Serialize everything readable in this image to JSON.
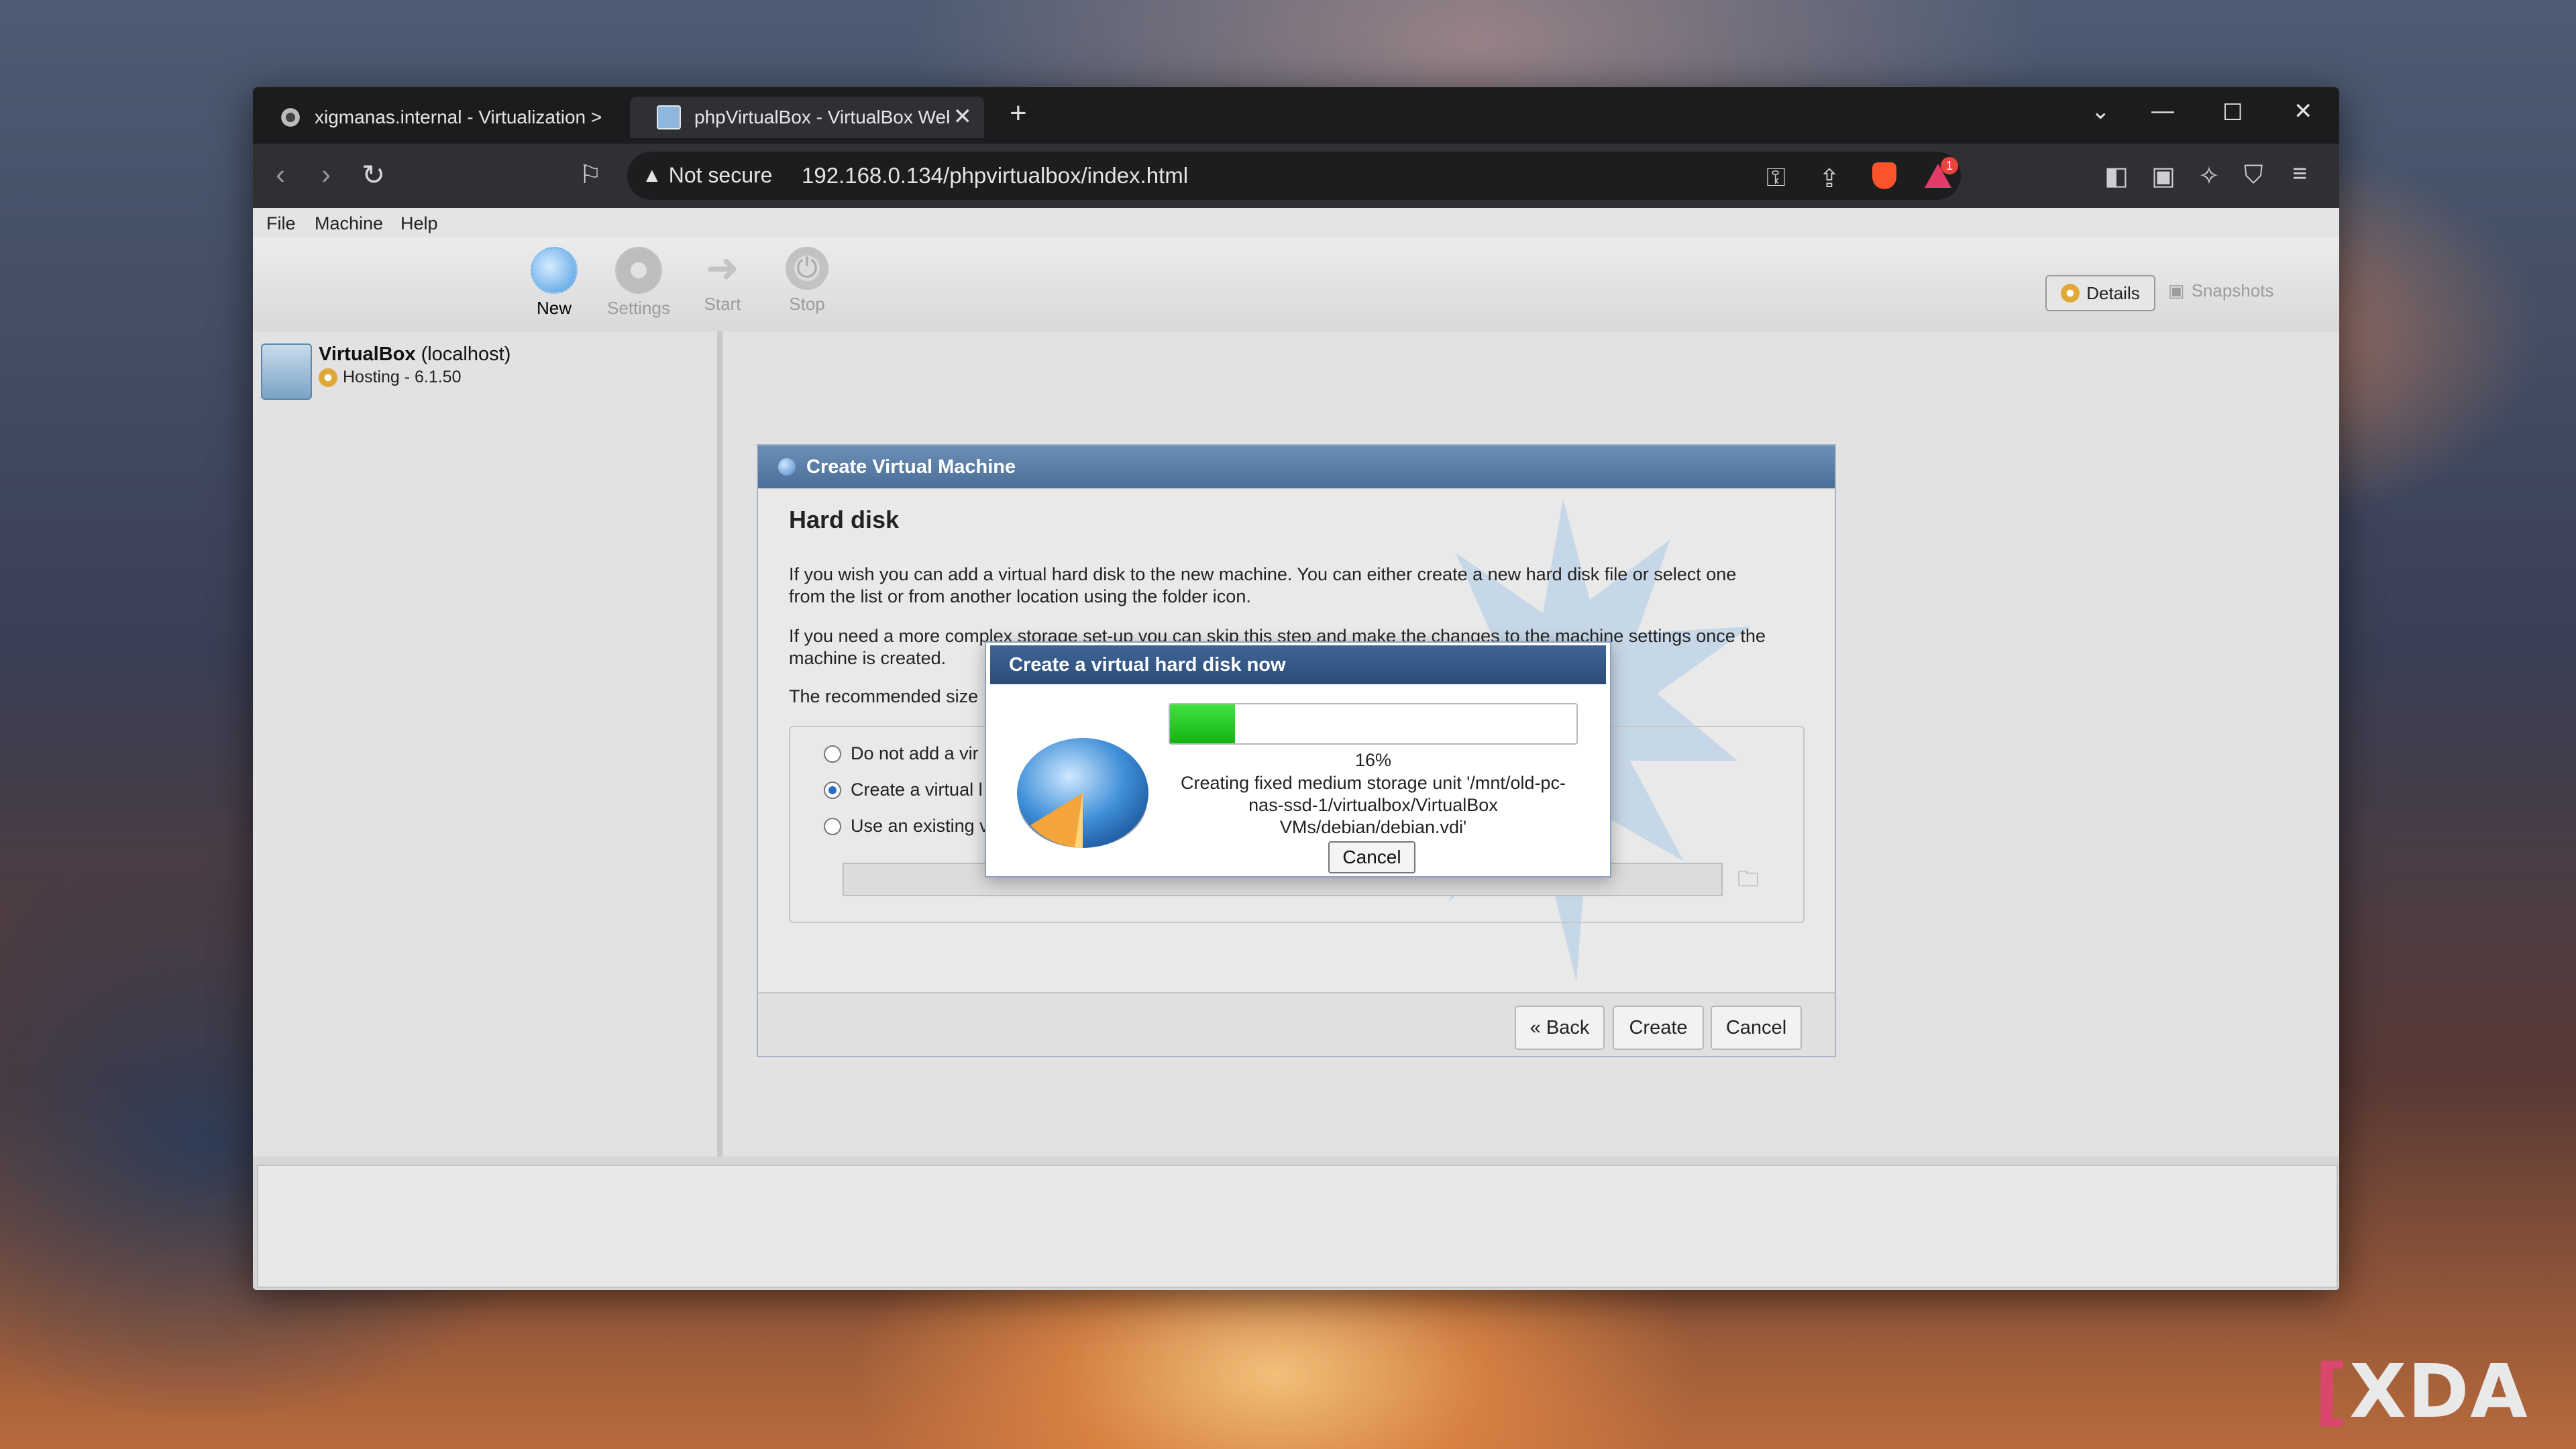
{
  "browser": {
    "tabs": [
      {
        "title": "xigmanas.internal - Virtualization >",
        "active": false
      },
      {
        "title": "phpVirtualBox - VirtualBox Web",
        "active": true
      }
    ],
    "security_label": "Not secure",
    "url": "192.168.0.134/phpvirtualbox/index.html",
    "notification_badge": "1"
  },
  "vbox": {
    "menu": [
      "File",
      "Machine",
      "Help"
    ],
    "toolbar": {
      "new": "New",
      "settings": "Settings",
      "start": "Start",
      "stop": "Stop"
    },
    "view_tabs": {
      "details": "Details",
      "snapshots": "Snapshots"
    },
    "host": {
      "name": "VirtualBox",
      "location": "(localhost)",
      "status": "Hosting - 6.1.50"
    }
  },
  "wizard": {
    "title": "Create Virtual Machine",
    "heading": "Hard disk",
    "para1_line1": "If you wish you can add a virtual hard disk to the new machine. You can either create a new hard disk file or select one",
    "para1_line2": "from the list or from another location using the folder icon.",
    "para2_line1": "If you need a more complex storage set-up you can skip this step and make the changes to the machine settings once the",
    "para2_line2": "machine is created.",
    "recommended": "The recommended size",
    "options": [
      "Do not add a vir",
      "Create a virtual l",
      "Use an existing v"
    ],
    "selected_option": 1,
    "buttons": {
      "back": "« Back",
      "create": "Create",
      "cancel": "Cancel"
    }
  },
  "progress_dialog": {
    "title": "Create a virtual hard disk now",
    "percent_value": 16,
    "percent_label": "16%",
    "message_lines": [
      "Creating fixed medium storage unit '/mnt/old-pc-",
      "nas-ssd-1/virtualbox/VirtualBox",
      "VMs/debian/debian.vdi'"
    ],
    "cancel_label": "Cancel"
  },
  "watermark": "XDA"
}
